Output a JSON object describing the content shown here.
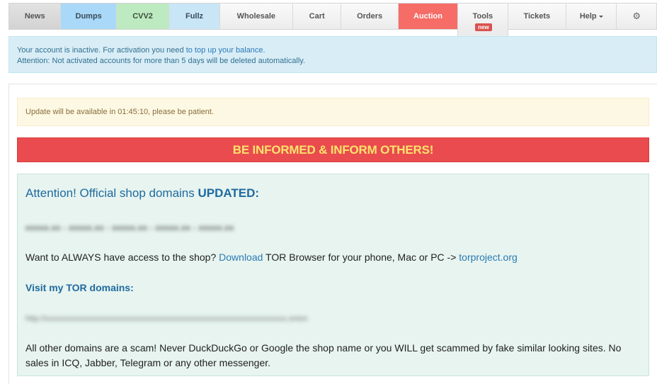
{
  "nav": {
    "items": [
      {
        "label": "News",
        "width": 74
      },
      {
        "label": "Dumps",
        "width": 79
      },
      {
        "label": "CVV2",
        "width": 75
      },
      {
        "label": "Fullz",
        "width": 72
      },
      {
        "label": "Wholesale",
        "width": 104
      },
      {
        "label": "Cart",
        "width": 69
      },
      {
        "label": "Orders",
        "width": 81
      },
      {
        "label": "Auction",
        "width": 85
      },
      {
        "label": "Tools",
        "width": 71
      },
      {
        "label": "Tickets",
        "width": 83
      },
      {
        "label": "Help",
        "width": 72
      }
    ],
    "tools_badge": "new",
    "settings_icon": "gear-icon"
  },
  "account_alert": {
    "line1_prefix": "Your account is inactive. For activation you need ",
    "line1_link": "to top up your balance.",
    "line2": "Attention: Not activated accounts for more than 5 days will be deleted automatically."
  },
  "update_notice": "Update will be available in 01:45:10, please be patient.",
  "banner": "BE INFORMED & INFORM OTHERS!",
  "notice": {
    "title_prefix": "Attention! Official shop domains ",
    "title_bold": "UPDATED:",
    "access_prefix": "Want to ALWAYS have access to the shop? ",
    "access_link": "Download",
    "access_middle": " TOR Browser for your phone, Mac or PC -> ",
    "access_link2": "torproject.org",
    "tor_heading": "Visit my TOR domains:",
    "scam_text": "All other domains are a scam! Never DuckDuckGo or Google the shop name or you WILL get scammed by fake similar looking sites. No sales in ICQ, Jabber, Telegram or any other messenger."
  },
  "colors": {
    "dumps": "#a9d8f8",
    "cvv2": "#bdeac0",
    "fullz": "#c9e6f7",
    "auction": "#f66c66",
    "banner_bg": "#e94b4f",
    "banner_text": "#ffe36b",
    "link": "#2a7ab6"
  }
}
